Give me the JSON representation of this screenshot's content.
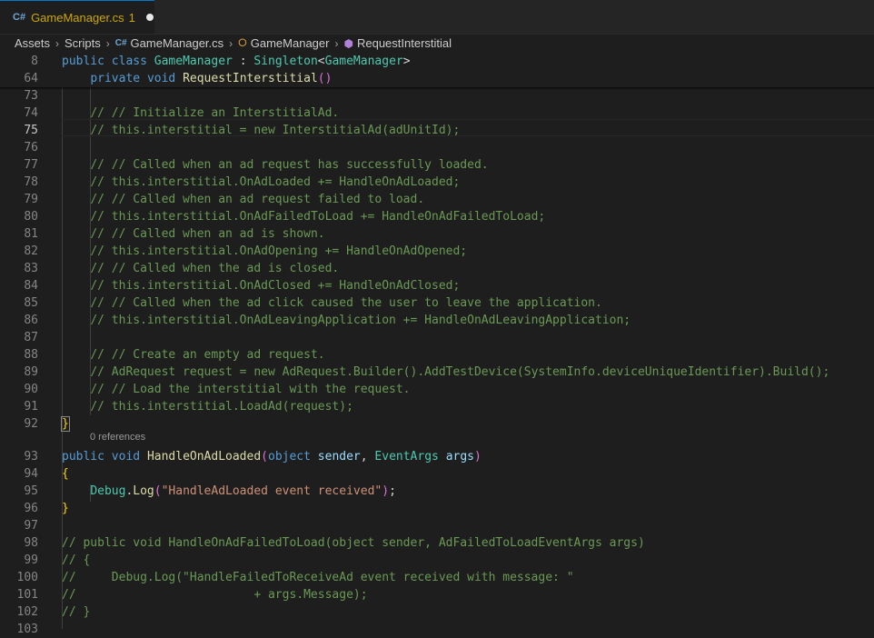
{
  "tab": {
    "icon": "csharp-file-icon",
    "filename": "GameManager.cs",
    "problems": "1"
  },
  "breadcrumb": [
    "Assets",
    "Scripts",
    "GameManager.cs",
    "GameManager",
    "RequestInterstitial"
  ],
  "sticky": [
    {
      "num": "8",
      "text": "public class GameManager : Singleton<GameManager>"
    },
    {
      "num": "64",
      "text": "    private void RequestInterstitial()"
    }
  ],
  "codelens": "0 references",
  "lines": [
    {
      "num": "73",
      "text": ""
    },
    {
      "num": "74",
      "text": "        // // Initialize an InterstitialAd."
    },
    {
      "num": "75",
      "text": "        // this.interstitial = new InterstitialAd(adUnitId);"
    },
    {
      "num": "76",
      "text": ""
    },
    {
      "num": "77",
      "text": "        // // Called when an ad request has successfully loaded."
    },
    {
      "num": "78",
      "text": "        // this.interstitial.OnAdLoaded += HandleOnAdLoaded;"
    },
    {
      "num": "79",
      "text": "        // // Called when an ad request failed to load."
    },
    {
      "num": "80",
      "text": "        // this.interstitial.OnAdFailedToLoad += HandleOnAdFailedToLoad;"
    },
    {
      "num": "81",
      "text": "        // // Called when an ad is shown."
    },
    {
      "num": "82",
      "text": "        // this.interstitial.OnAdOpening += HandleOnAdOpened;"
    },
    {
      "num": "83",
      "text": "        // // Called when the ad is closed."
    },
    {
      "num": "84",
      "text": "        // this.interstitial.OnAdClosed += HandleOnAdClosed;"
    },
    {
      "num": "85",
      "text": "        // // Called when the ad click caused the user to leave the application."
    },
    {
      "num": "86",
      "text": "        // this.interstitial.OnAdLeavingApplication += HandleOnAdLeavingApplication;"
    },
    {
      "num": "87",
      "text": ""
    },
    {
      "num": "88",
      "text": "        // // Create an empty ad request."
    },
    {
      "num": "89",
      "text": "        // AdRequest request = new AdRequest.Builder().AddTestDevice(SystemInfo.deviceUniqueIdentifier).Build();"
    },
    {
      "num": "90",
      "text": "        // // Load the interstitial with the request."
    },
    {
      "num": "91",
      "text": "        // this.interstitial.LoadAd(request);"
    },
    {
      "num": "92",
      "text": "    }"
    },
    {
      "num": "93",
      "text": "    public void HandleOnAdLoaded(object sender, EventArgs args)"
    },
    {
      "num": "94",
      "text": "    {"
    },
    {
      "num": "95",
      "text": "        Debug.Log(\"HandleAdLoaded event received\");"
    },
    {
      "num": "96",
      "text": "    }"
    },
    {
      "num": "97",
      "text": ""
    },
    {
      "num": "98",
      "text": "    // public void HandleOnAdFailedToLoad(object sender, AdFailedToLoadEventArgs args)"
    },
    {
      "num": "99",
      "text": "    // {"
    },
    {
      "num": "100",
      "text": "    //     Debug.Log(\"HandleFailedToReceiveAd event received with message: \""
    },
    {
      "num": "101",
      "text": "    //                         + args.Message);"
    },
    {
      "num": "102",
      "text": "    // }"
    },
    {
      "num": "103",
      "text": ""
    }
  ]
}
